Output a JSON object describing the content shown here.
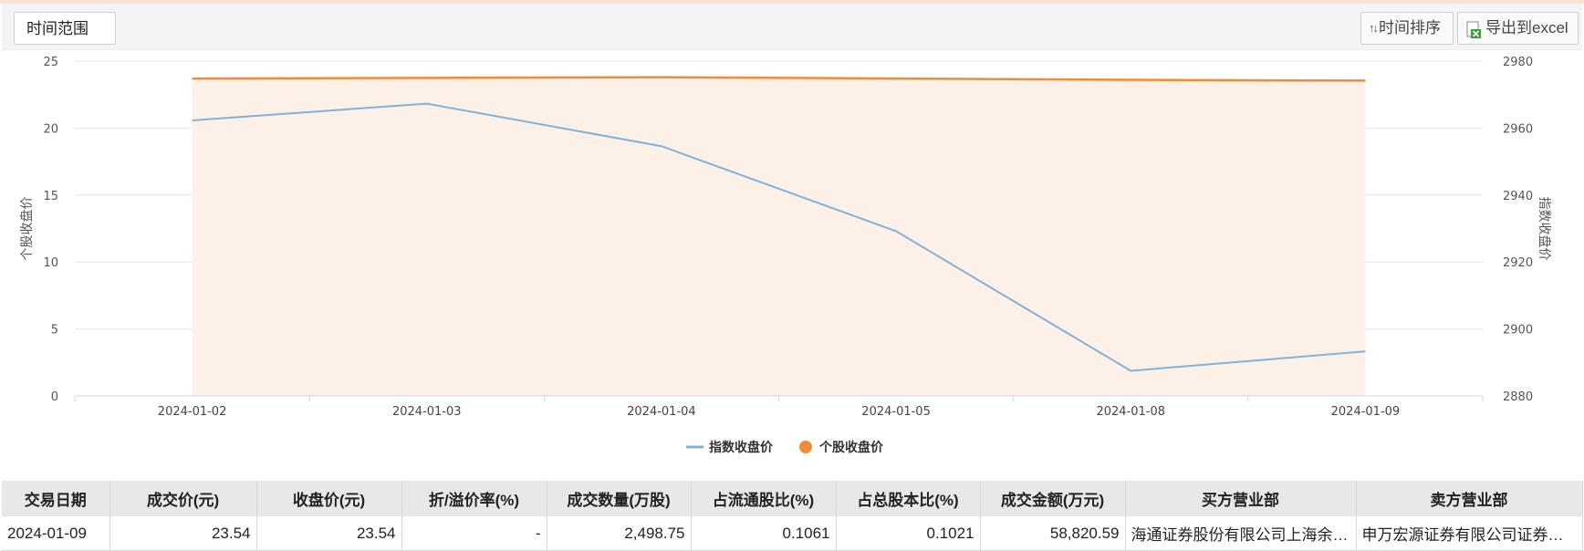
{
  "toolbar": {
    "range_label": "时间范围",
    "sort_label": "时间排序",
    "export_label": "导出到excel",
    "sort_icon": "sort-arrows-icon",
    "export_icon": "excel-icon"
  },
  "chart_data": {
    "type": "line",
    "categories": [
      "2024-01-02",
      "2024-01-03",
      "2024-01-04",
      "2024-01-05",
      "2024-01-08",
      "2024-01-09"
    ],
    "series": [
      {
        "name": "指数收盘价",
        "axis": "right",
        "style": "line",
        "color": "#7fb2dc",
        "values": [
          2962.3,
          2967.3,
          2954.6,
          2929.2,
          2887.5,
          2893.3
        ]
      },
      {
        "name": "个股收盘价",
        "axis": "left",
        "style": "area",
        "color": "#ef8c3a",
        "fill": "#fdf0e6",
        "values": [
          23.7,
          23.75,
          23.8,
          23.7,
          23.6,
          23.54
        ]
      }
    ],
    "left_axis": {
      "label": "个股收盘价",
      "ylim": [
        0,
        25
      ],
      "ticks": [
        "0",
        "5",
        "10",
        "15",
        "20",
        "25"
      ]
    },
    "right_axis": {
      "label": "指数收盘价",
      "ylim": [
        2880,
        2980
      ],
      "ticks": [
        "2880",
        "2900",
        "2920",
        "2940",
        "2960",
        "2980"
      ]
    },
    "grid": true,
    "legend_position": "bottom-center"
  },
  "table": {
    "headers": [
      "交易日期",
      "成交价(元)",
      "收盘价(元)",
      "折/溢价率(%)",
      "成交数量(万股)",
      "占流通股比(%)",
      "占总股本比(%)",
      "成交金额(万元)",
      "买方营业部",
      "卖方营业部"
    ],
    "rows": [
      [
        "2024-01-09",
        "23.54",
        "23.54",
        "-",
        "2,498.75",
        "0.1061",
        "0.1021",
        "58,820.59",
        "海通证券股份有限公司上海余…",
        "申万宏源证券有限公司证券投…"
      ]
    ]
  }
}
